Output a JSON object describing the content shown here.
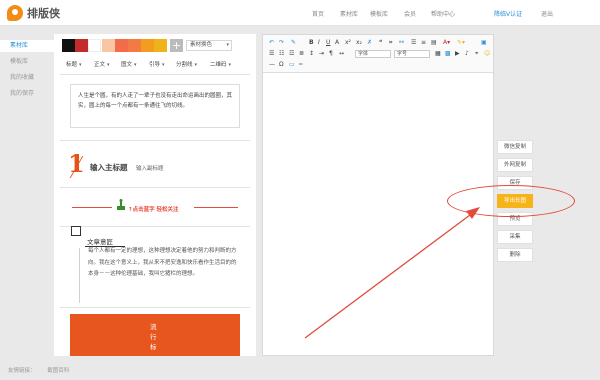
{
  "brand": {
    "name": "排版侠"
  },
  "nav": {
    "links": [
      "首页",
      "素材库",
      "模板库",
      "会员",
      "帮助中心"
    ],
    "user": "降临V认证",
    "logout": "退出"
  },
  "sidebar": {
    "items": [
      {
        "label": "素材库",
        "active": true
      },
      {
        "label": "模板库",
        "active": false
      },
      {
        "label": "我的收藏",
        "active": false
      },
      {
        "label": "我的保存",
        "active": false
      }
    ]
  },
  "palette": {
    "swatches": [
      "#111111",
      "#c42b2b",
      "#ffffff",
      "#f7c6a3",
      "#f26c4a",
      "#f37a42",
      "#f39c1e",
      "#f0b21a"
    ],
    "add_label": "+",
    "theme_select": "素材换色",
    "tabs": [
      "标题",
      "正文",
      "图文",
      "引导",
      "分割线",
      "二维码"
    ]
  },
  "material": {
    "quote": "人生是个圆，有的人走了一辈子也没有走出命运画出的圆圈，其实，圆上的每一个点都有一条通往飞的切线。",
    "heading_number": "1",
    "heading_main": "输入主标题",
    "heading_sub": "输入副标题",
    "follow_text": "↑点击蓝字 轻松关注",
    "article_title": "文章意匠",
    "article_body": "每个人都有一定的理想，这种理想决定着他的努力和判断的方向。我在这个意义上，我从来不把安逸和快乐看作生活目的的本身－－这种伦理基础，我叫它猪栏的理想。",
    "orange_text": "流行标"
  },
  "editor": {
    "font_select": "字体",
    "size_select": "字号"
  },
  "actions": [
    "微信复制",
    "外网复制",
    "保存",
    "导出长图",
    "预览",
    "采集",
    "删除"
  ],
  "active_action": "导出长图",
  "footer": {
    "label": "友情链接：",
    "link": "截图百科"
  },
  "colors": {
    "accent_orange": "#f7b31a",
    "annotation_red": "#e24a3b",
    "brand_orange": "#f28c16"
  }
}
